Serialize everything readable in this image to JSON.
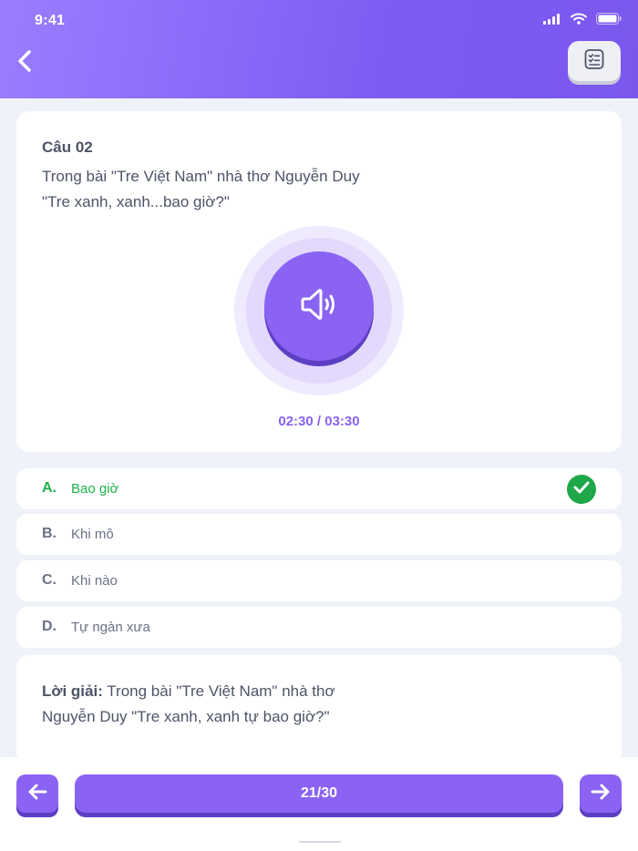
{
  "status_bar": {
    "time": "9:41"
  },
  "question": {
    "number": "Câu 02",
    "text": "Trong bài \"Tre Việt Nam\" nhà thơ Nguyễn Duy  \"Tre xanh, xanh...bao giờ?\"",
    "audio_time": "02:30 / 03:30"
  },
  "options": [
    {
      "letter": "A.",
      "text": "Bao giờ",
      "correct": true
    },
    {
      "letter": "B.",
      "text": "Khi mô",
      "correct": false
    },
    {
      "letter": "C.",
      "text": "Khi nào",
      "correct": false
    },
    {
      "letter": "D.",
      "text": "Tự ngàn xưa",
      "correct": false
    }
  ],
  "solution": {
    "label": "Lời giải:",
    "text": " Trong bài \"Tre Việt Nam\" nhà thơ Nguyễn Duy  \"Tre xanh, xanh tự bao giờ?\""
  },
  "footer": {
    "progress": "21/30"
  },
  "icons": {
    "back": "chevron-left-icon",
    "list": "checklist-icon",
    "audio": "speaker-icon",
    "correct": "check-icon",
    "prev": "arrow-left-icon",
    "next": "arrow-right-icon"
  },
  "colors": {
    "accent": "#8a63f2",
    "header_start": "#9b7dff",
    "header_end": "#7b57ee",
    "correct": "#1fb24a",
    "background": "#eff2f9"
  }
}
